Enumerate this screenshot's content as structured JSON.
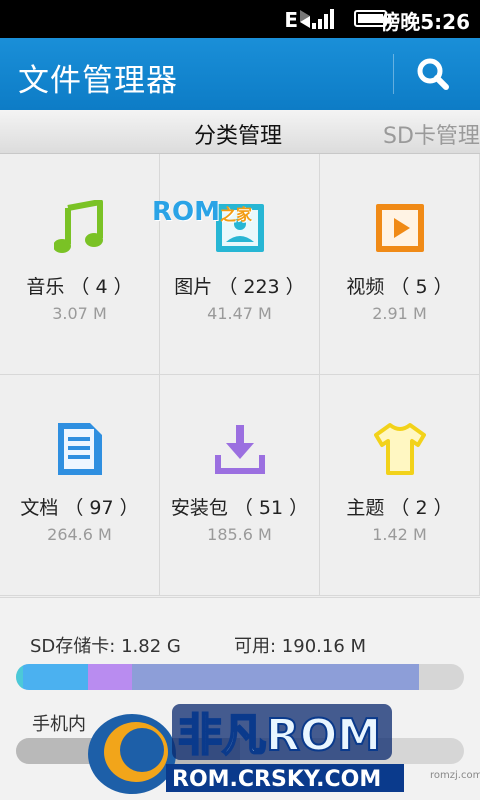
{
  "status": {
    "network": "E",
    "time": "傍晚5:26"
  },
  "app": {
    "title": "文件管理器"
  },
  "tabs": [
    {
      "label": "分类管理"
    },
    {
      "label": "SD卡管理"
    }
  ],
  "categories": [
    {
      "name": "音乐 （ 4 ）",
      "size": "3.07 M",
      "icon": "music-note-icon",
      "color": "#7ac225"
    },
    {
      "name": "图片 （ 223 ）",
      "size": "41.47 M",
      "icon": "picture-icon",
      "color": "#27b6d4"
    },
    {
      "name": "视频 （ 5 ）",
      "size": "2.91 M",
      "icon": "video-play-icon",
      "color": "#f08a16"
    },
    {
      "name": "文档 （ 97 ）",
      "size": "264.6 M",
      "icon": "document-icon",
      "color": "#2f8fe0"
    },
    {
      "name": "安装包 （ 51 ）",
      "size": "185.6 M",
      "icon": "download-install-icon",
      "color": "#9b6fe0"
    },
    {
      "name": "主题 （ 2 ）",
      "size": "1.42 M",
      "icon": "tshirt-theme-icon",
      "color": "#f2d21a"
    }
  ],
  "storage": {
    "sd_label": "SD存储卡: 1.82 G",
    "sd_available": "可用: 190.16 M",
    "sd_segments": [
      {
        "name": "music",
        "fraction": 0.015,
        "color": "#4cc9d8"
      },
      {
        "name": "pictures",
        "fraction": 0.145,
        "color": "#4bb1f0"
      },
      {
        "name": "installers",
        "fraction": 0.1,
        "color": "#b98cf0"
      },
      {
        "name": "documents",
        "fraction": 0.64,
        "color": "#8d9ed8"
      }
    ],
    "phone_label": "手机内",
    "phone_used_fraction": 0.5,
    "phone_color": "#b9b9b9"
  },
  "watermark": {
    "rom_text": "ROM",
    "rom_suffix": "之家",
    "brand": "非凡ROM",
    "url": "ROM.CRSKY.COM",
    "site": "romzj.com"
  }
}
